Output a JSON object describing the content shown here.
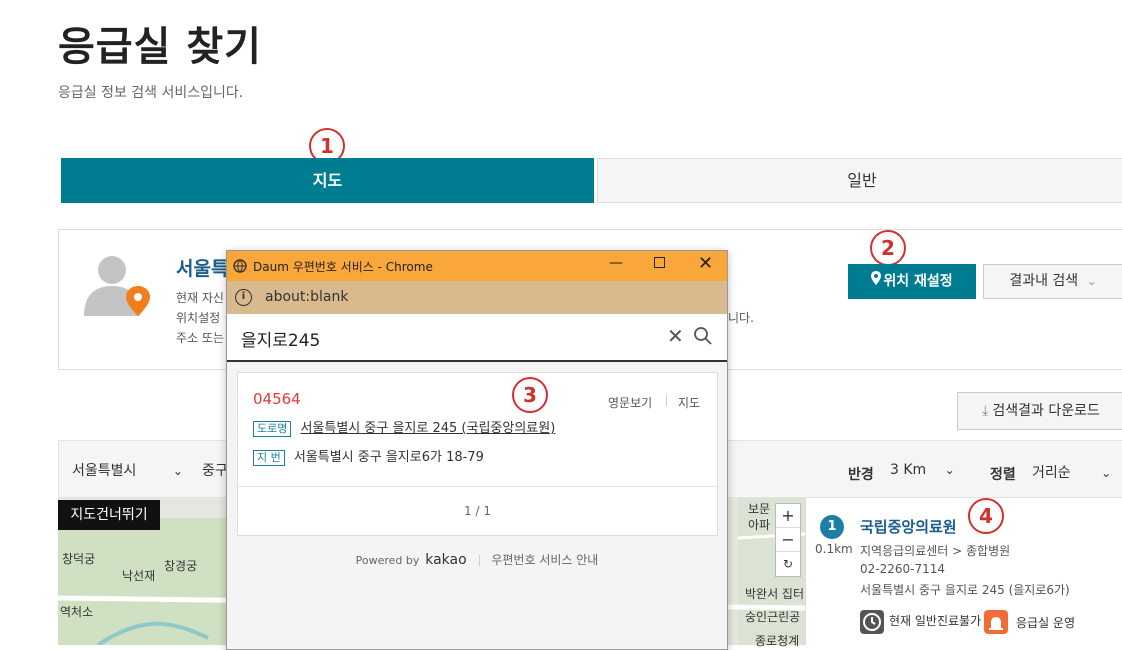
{
  "page": {
    "title": "응급실 찾기",
    "subtitle": "응급실 정보 검색 서비스입니다."
  },
  "steps": [
    "1",
    "2",
    "3",
    "4"
  ],
  "tabs": {
    "map": "지도",
    "general": "일반"
  },
  "location": {
    "title": "서울특",
    "line1": "현재 자신",
    "line2": "위치설정",
    "line3": "주소 또는",
    "line2_tail": "니다."
  },
  "buttons": {
    "reset_location": "위치 재설정",
    "search_within": "결과내 검색",
    "download": "검색결과 다운로드"
  },
  "filters": {
    "region": "서울특별시",
    "district": "중구",
    "radius_label": "반경",
    "radius_value": "3 Km",
    "sort_label": "정렬",
    "sort_value": "거리순"
  },
  "map": {
    "skip": "지도건너뛰기",
    "labels": [
      "창덕궁",
      "창경궁",
      "낙선재",
      "역처소",
      "보문",
      "아파",
      "박완서 집터",
      "숭인근린공",
      "종로청계"
    ],
    "zoom_in": "+",
    "zoom_out": "−",
    "reset": "↻"
  },
  "result": {
    "rank": "1",
    "distance": "0.1km",
    "name": "국립중앙의료원",
    "category": "지역응급의료센터 > 종합병원",
    "phone": "02-2260-7114",
    "address": "서울특별시 중구 을지로 245 (을지로6가)",
    "status1": "현재 일반진료불가",
    "status2": "응급실 운영"
  },
  "popup": {
    "window_title": "Daum 우편번호 서비스 - Chrome",
    "url": "about:blank",
    "query": "을지로245",
    "zipcode": "04564",
    "english_view": "영문보기",
    "map_link": "지도",
    "road_tag": "도로명",
    "road_address": "서울특별시 중구 을지로 245 (국립중앙의료원)",
    "jibun_tag": "지 번",
    "jibun_address": "서울특별시 중구 을지로6가 18-79",
    "pagination": "1 / 1",
    "powered_by": "Powered by",
    "brand": "kakao",
    "guide": "우편번호 서비스 안내"
  },
  "colors": {
    "primary": "#007c92",
    "annotation": "#d32f2f",
    "popup_title_bar": "#f9a73b",
    "zipcode": "#e53935"
  }
}
